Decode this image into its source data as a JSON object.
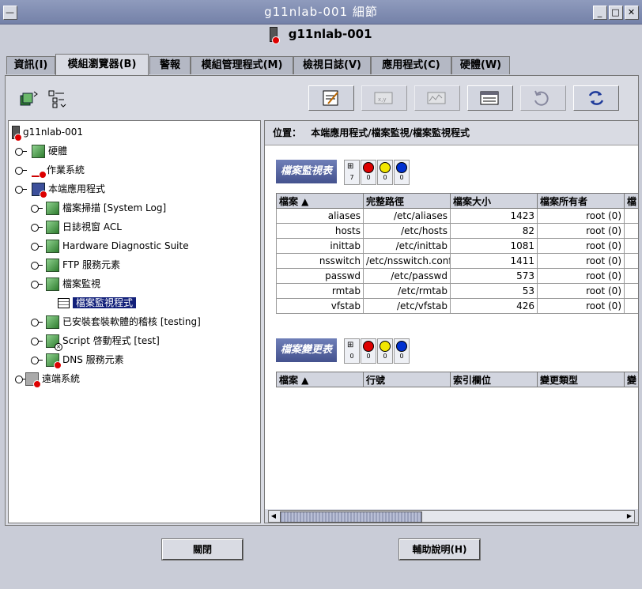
{
  "window": {
    "title": "g11nlab-001 細節",
    "host": "g11nlab-001"
  },
  "tabs": [
    "資訊(I)",
    "模組瀏覽器(B)",
    "警報",
    "模組管理程式(M)",
    "檢視日誌(V)",
    "應用程式(C)",
    "硬體(W)"
  ],
  "tree": {
    "root": "g11nlab-001",
    "items": [
      "硬體",
      "作業系統",
      "本端應用程式",
      "檔案掃描 [System Log]",
      "日誌視窗 ACL",
      "Hardware Diagnostic Suite",
      "FTP 服務元素",
      "檔案監視",
      "檔案監視程式",
      "已安裝套裝軟體的稽核 [testing]",
      "Script 啓動程式 [test]",
      "DNS 服務元素",
      "遠端系統"
    ]
  },
  "location": {
    "label": "位置：",
    "path": "本端應用程式/檔案監視/檔案監視程式"
  },
  "monitor": {
    "title": "檔案監視表",
    "counts": [
      "7",
      "0",
      "0",
      "0"
    ],
    "headers": [
      "檔案 ▲",
      "完整路徑",
      "檔案大小",
      "檔案所有者",
      "檔"
    ],
    "rows": [
      [
        "aliases",
        "/etc/aliases",
        "1423",
        "root (0)"
      ],
      [
        "hosts",
        "/etc/hosts",
        "82",
        "root (0)"
      ],
      [
        "inittab",
        "/etc/inittab",
        "1081",
        "root (0)"
      ],
      [
        "nsswitch",
        "/etc/nsswitch.conf",
        "1411",
        "root (0)"
      ],
      [
        "passwd",
        "/etc/passwd",
        "573",
        "root (0)"
      ],
      [
        "rmtab",
        "/etc/rmtab",
        "53",
        "root (0)"
      ],
      [
        "vfstab",
        "/etc/vfstab",
        "426",
        "root (0)"
      ]
    ]
  },
  "change": {
    "title": "檔案變更表",
    "counts": [
      "0",
      "0",
      "0",
      "0"
    ],
    "headers": [
      "檔案 ▲",
      "行號",
      "索引欄位",
      "變更類型",
      "變"
    ]
  },
  "buttons": {
    "close": "關閉",
    "help": "輔助說明(H)"
  }
}
